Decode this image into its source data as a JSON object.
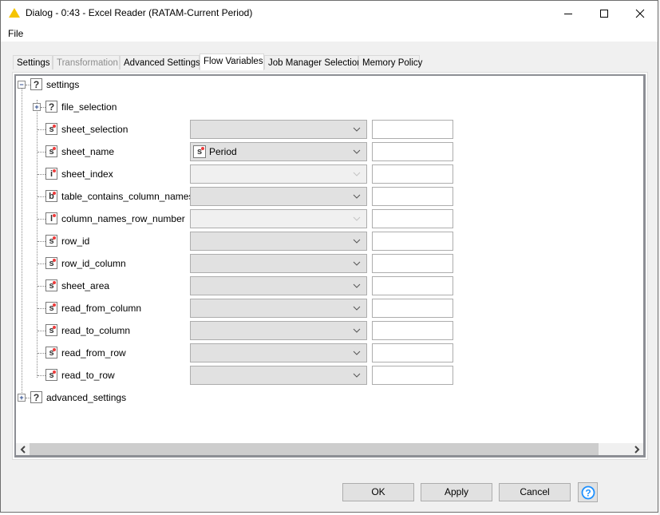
{
  "window": {
    "title": "Dialog - 0:43 - Excel Reader (RATAM-Current Period)",
    "title_icon": "warning-triangle-icon",
    "controls": {
      "minimize": "minimize-icon",
      "maximize": "maximize-icon",
      "close": "close-icon"
    }
  },
  "menubar": {
    "items": [
      {
        "label": "File"
      }
    ]
  },
  "tabs": [
    {
      "label": "Settings",
      "state": "normal"
    },
    {
      "label": "Transformation",
      "state": "disabled"
    },
    {
      "label": "Advanced Settings",
      "state": "normal"
    },
    {
      "label": "Flow Variables",
      "state": "active"
    },
    {
      "label": "Job Manager Selection",
      "state": "normal"
    },
    {
      "label": "Memory Policy",
      "state": "normal"
    }
  ],
  "tree": {
    "root": {
      "label": "settings",
      "icon": "?",
      "expanded": true
    },
    "children": [
      {
        "label": "file_selection",
        "icon": "?",
        "type": "group",
        "expanded": false
      },
      {
        "label": "sheet_selection",
        "icon": "s",
        "type": "string",
        "variable": "",
        "enabled": true,
        "override": ""
      },
      {
        "label": "sheet_name",
        "icon": "s",
        "type": "string",
        "variable": "Period",
        "variable_icon": "s",
        "enabled": true,
        "override": ""
      },
      {
        "label": "sheet_index",
        "icon": "i",
        "type": "integer",
        "variable": "",
        "enabled": false,
        "override": ""
      },
      {
        "label": "table_contains_column_names",
        "icon": "b",
        "type": "boolean",
        "variable": "",
        "enabled": true,
        "override": ""
      },
      {
        "label": "column_names_row_number",
        "icon": "l",
        "type": "long",
        "variable": "",
        "enabled": false,
        "override": ""
      },
      {
        "label": "row_id",
        "icon": "s",
        "type": "string",
        "variable": "",
        "enabled": true,
        "override": ""
      },
      {
        "label": "row_id_column",
        "icon": "s",
        "type": "string",
        "variable": "",
        "enabled": true,
        "override": ""
      },
      {
        "label": "sheet_area",
        "icon": "s",
        "type": "string",
        "variable": "",
        "enabled": true,
        "override": ""
      },
      {
        "label": "read_from_column",
        "icon": "s",
        "type": "string",
        "variable": "",
        "enabled": true,
        "override": ""
      },
      {
        "label": "read_to_column",
        "icon": "s",
        "type": "string",
        "variable": "",
        "enabled": true,
        "override": ""
      },
      {
        "label": "read_from_row",
        "icon": "s",
        "type": "string",
        "variable": "",
        "enabled": true,
        "override": ""
      },
      {
        "label": "read_to_row",
        "icon": "s",
        "type": "string",
        "variable": "",
        "enabled": true,
        "override": ""
      }
    ],
    "sibling": {
      "label": "advanced_settings",
      "icon": "?",
      "expanded": false
    }
  },
  "buttons": {
    "ok": "OK",
    "apply": "Apply",
    "cancel": "Cancel",
    "help_icon": "help-icon"
  },
  "colors": {
    "variable_dot": "#ee3b3b",
    "title_icon": "#f5c400",
    "help_icon": "#1e90ff"
  }
}
